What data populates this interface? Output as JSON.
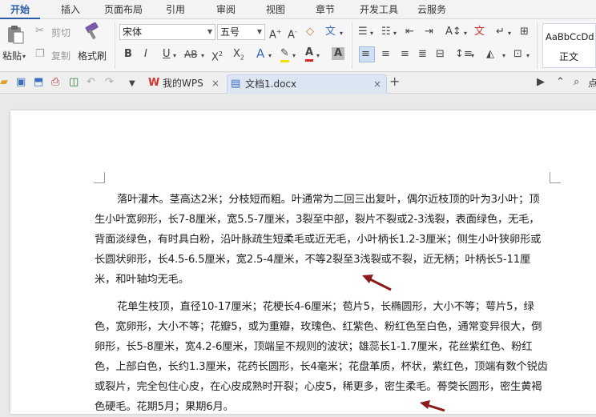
{
  "menu": {
    "items": [
      "开始",
      "插入",
      "页面布局",
      "引用",
      "审阅",
      "视图",
      "章节",
      "开发工具",
      "云服务"
    ]
  },
  "ribbon": {
    "paste": "粘贴",
    "cut": "剪切",
    "copy": "复制",
    "format_painter": "格式刷",
    "font_name": "宋体",
    "font_size": "五号",
    "style_preview": "AaBbCcDd",
    "style_name": "正文"
  },
  "tabs": {
    "home_tab": "我的WPS",
    "doc_tab": "文档1.docx",
    "right_label": "点"
  },
  "document": {
    "paragraph1": "落叶灌木。茎高达2米；分枝短而粗。叶通常为二回三出复叶，偶尔近枝顶的叶为3小叶；顶生小叶宽卵形，长7-8厘米，宽5.5-7厘米，3裂至中部，裂片不裂或2-3浅裂，表面绿色，无毛，背面淡绿色，有时具白粉，沿叶脉疏生短柔毛或近无毛，小叶柄长1.2-3厘米；侧生小叶狭卵形或长圆状卵形，长4.5-6.5厘米，宽2.5-4厘米，不等2裂至3浅裂或不裂，近无柄；叶柄长5-11厘米，和叶轴均无毛。",
    "paragraph2": "花单生枝顶，直径10-17厘米；花梗长4-6厘米；苞片5，长椭圆形，大小不等；萼片5，绿色，宽卵形，大小不等；花瓣5，或为重瓣，玫瑰色、红紫色、粉红色至白色，通常变异很大，倒卵形，长5-8厘米，宽4.2-6厘米，顶端呈不规则的波状；雄蕊长1-1.7厘米，花丝紫红色、粉红色，上部白色，长约1.3厘米，花药长圆形，长4毫米；花盘革质，杯状，紫红色，顶端有数个锐齿或裂片，完全包住心皮，在心皮成熟时开裂；心皮5，稀更多，密生柔毛。蓇葖长圆形，密生黄褐色硬毛。花期5月；果期6月。"
  },
  "colors": {
    "accent": "#2b5ca8",
    "arrow": "#8b1a1a",
    "wps_red": "#d2322d"
  }
}
